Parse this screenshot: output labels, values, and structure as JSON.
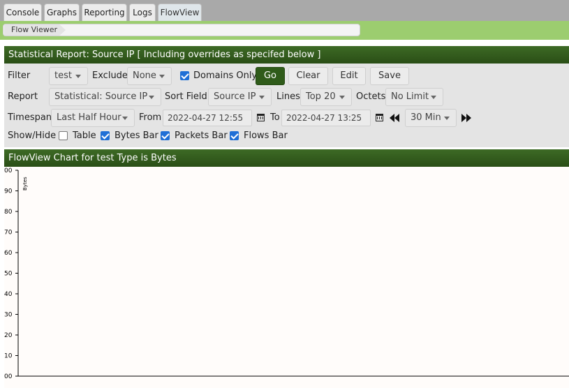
{
  "tabs": [
    {
      "label": "Console",
      "active": false
    },
    {
      "label": "Graphs",
      "active": false
    },
    {
      "label": "Reporting",
      "active": false
    },
    {
      "label": "Logs",
      "active": false
    },
    {
      "label": "FlowView",
      "active": true
    }
  ],
  "breadcrumb": {
    "label": "Flow Viewer"
  },
  "report": {
    "title": "Statistical Report: Source IP [ Including overrides as specifed below ]",
    "filter": {
      "label": "Filter",
      "value": "test"
    },
    "exclude": {
      "label": "Exclude",
      "value": "None"
    },
    "domains_only": {
      "label": "Domains Only",
      "checked": true
    },
    "buttons": {
      "go": "Go",
      "clear": "Clear",
      "edit": "Edit",
      "save": "Save"
    },
    "report_type": {
      "label": "Report",
      "value": "Statistical: Source IP"
    },
    "sort_field": {
      "label": "Sort Field",
      "value": "Source IP"
    },
    "lines": {
      "label": "Lines",
      "value": "Top 20"
    },
    "octets": {
      "label": "Octets",
      "value": "No Limit"
    },
    "timespan": {
      "label": "Timespan",
      "value": "Last Half Hour"
    },
    "from": {
      "label": "From",
      "value": "2022-04-27 12:55"
    },
    "to": {
      "label": "To",
      "value": "2022-04-27 13:25"
    },
    "interval": {
      "value": "30 Min"
    },
    "show_hide": {
      "label": "Show/Hide",
      "options": [
        {
          "label": "Table",
          "checked": false
        },
        {
          "label": "Bytes Bar",
          "checked": true
        },
        {
          "label": "Packets Bar",
          "checked": true
        },
        {
          "label": "Flows Bar",
          "checked": true
        }
      ]
    }
  },
  "chart": {
    "title": "FlowView Chart for test Type is Bytes"
  },
  "chart_data": {
    "type": "bar",
    "title": "FlowView Chart for test Type is Bytes",
    "xlabel": "",
    "ylabel": "Bytes",
    "categories": [],
    "values": [],
    "ytick_labels": [
      "00",
      "90",
      "80",
      "70",
      "60",
      "50",
      "40",
      "30",
      "20",
      "10",
      "00"
    ],
    "grid": false,
    "legend": "none"
  }
}
